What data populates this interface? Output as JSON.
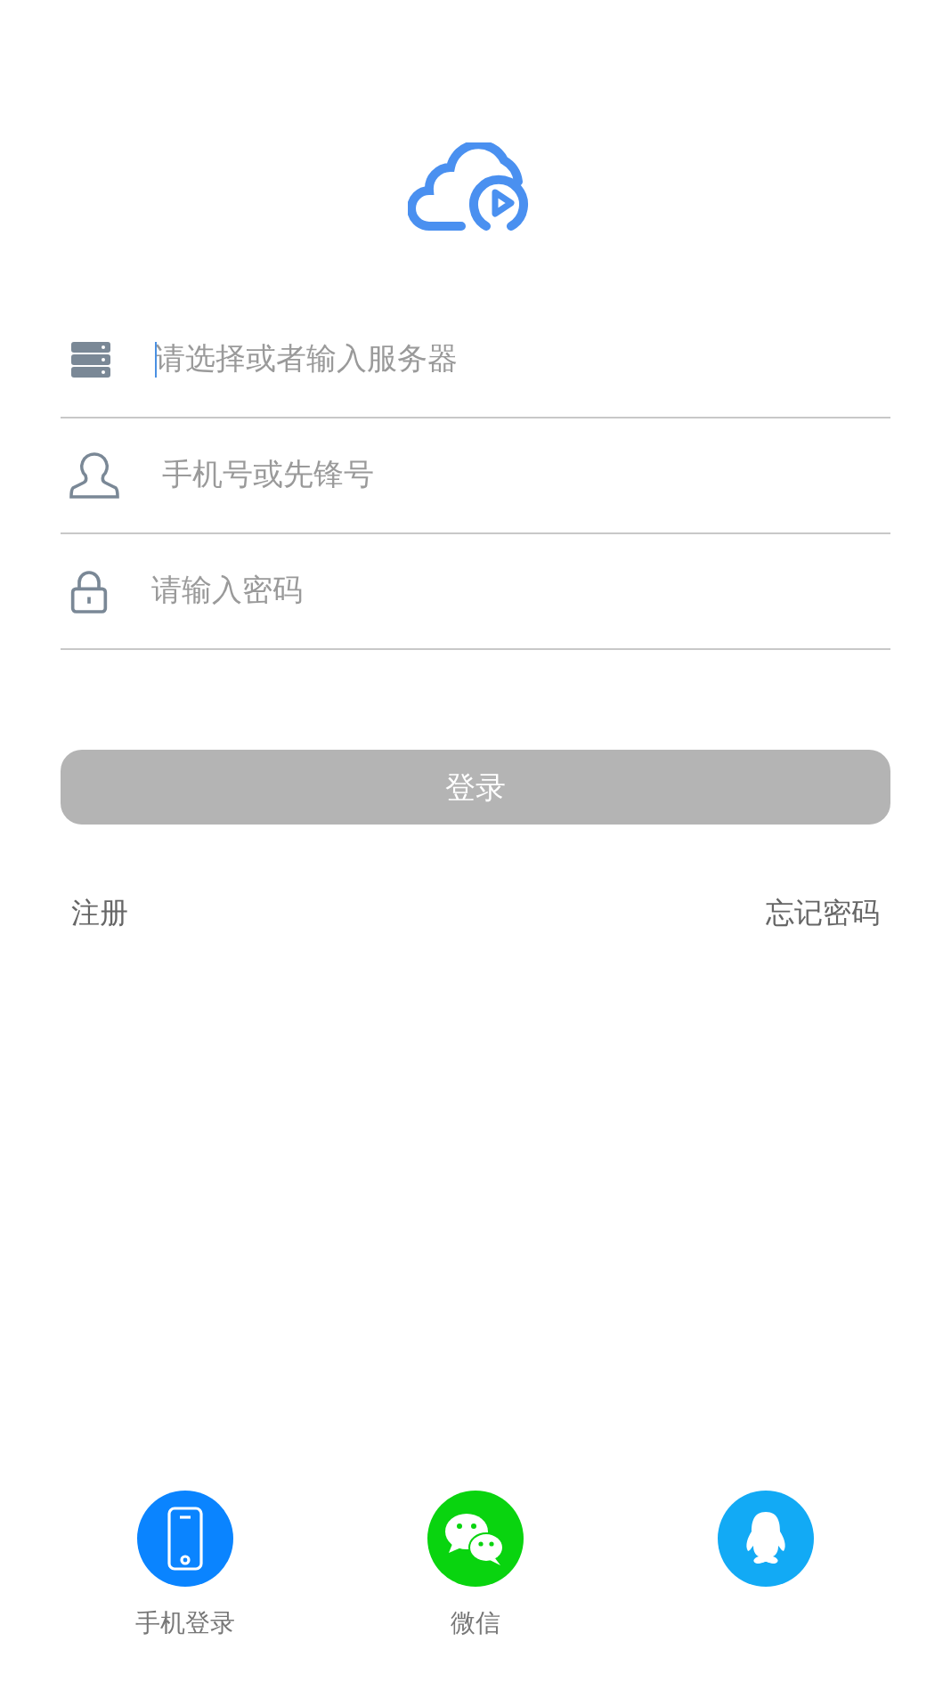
{
  "fields": [
    {
      "kind": "server",
      "placeholder": "请选择或者输入服务器",
      "focused": true
    },
    {
      "kind": "user",
      "placeholder": "手机号或先锋号",
      "focused": false
    },
    {
      "kind": "lock",
      "placeholder": "请输入密码",
      "focused": false
    }
  ],
  "login_button": {
    "label": "登录",
    "disabled": true
  },
  "links": [
    "注册",
    "忘记密码"
  ],
  "social": [
    {
      "kind": "phone",
      "label": "手机登录",
      "color": "#0a84ff"
    },
    {
      "kind": "wechat",
      "label": "微信",
      "color": "#09d40f"
    },
    {
      "kind": "qq",
      "color": "#12aaf5"
    }
  ]
}
